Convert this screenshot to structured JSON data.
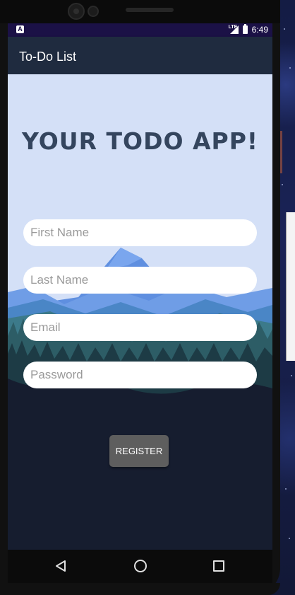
{
  "status_bar": {
    "time": "6:49",
    "network": "LTE",
    "app_badge": "A"
  },
  "app_bar": {
    "title": "To-Do List"
  },
  "main": {
    "headline": "YOUR TODO APP!",
    "fields": {
      "first_name": {
        "placeholder": "First Name",
        "value": ""
      },
      "last_name": {
        "placeholder": "Last Name",
        "value": ""
      },
      "email": {
        "placeholder": "Email",
        "value": ""
      },
      "password": {
        "placeholder": "Password",
        "value": ""
      }
    },
    "register_label": "REGISTER"
  },
  "colors": {
    "app_bar": "#1f2b3f",
    "status_bar": "#1b1146",
    "sky": "#d4e0f7",
    "headline": "#34455e",
    "button": "#5e5e5e"
  },
  "nav_bar": {
    "icons": [
      "back-icon",
      "home-icon",
      "recents-icon"
    ]
  }
}
